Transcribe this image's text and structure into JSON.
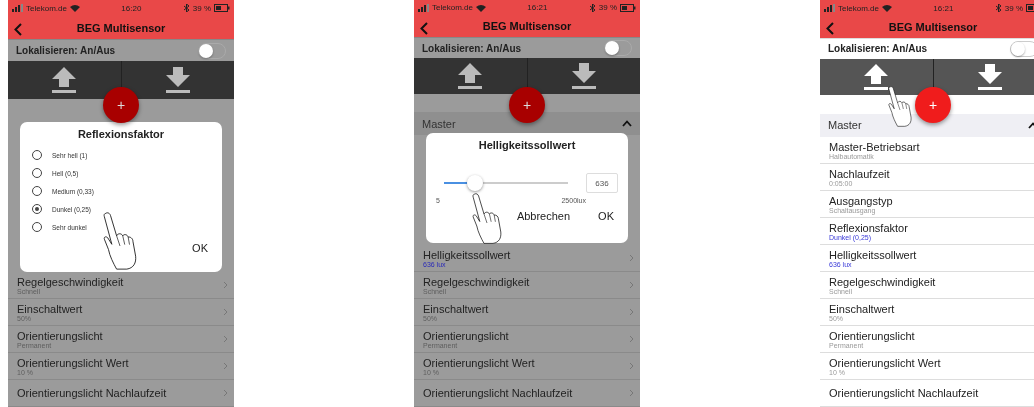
{
  "phones": [
    {
      "dimmed": true,
      "status": {
        "carrier": "Telekom.de",
        "time": "16:20",
        "battery": "39 %"
      },
      "title": "BEG Multisensor",
      "locate": {
        "label": "Lokalisieren: An/Aus",
        "on": false
      },
      "plus": "+",
      "dialog": {
        "kind": "radio",
        "title": "Reflexionsfaktor",
        "options": [
          {
            "label": "Sehr hell (1)",
            "selected": false
          },
          {
            "label": "Hell (0,5)",
            "selected": false
          },
          {
            "label": "Medium (0,33)",
            "selected": false
          },
          {
            "label": "Dunkel (0,25)",
            "selected": true
          },
          {
            "label": "Sehr dunkel",
            "selected": false
          }
        ],
        "buttons": [
          "OK"
        ]
      },
      "rows": [
        {
          "title": "Regelgeschwindigkeit",
          "value": "Schnell",
          "highlighted": false
        },
        {
          "title": "Einschaltwert",
          "value": "50%",
          "highlighted": false
        },
        {
          "title": "Orientierungslicht",
          "value": "Permanent",
          "highlighted": false
        },
        {
          "title": "Orientierungslicht Wert",
          "value": "10 %",
          "highlighted": false
        },
        {
          "title": "Orientierungslicht Nachlaufzeit"
        }
      ]
    },
    {
      "dimmed": true,
      "status": {
        "carrier": "Telekom.de",
        "time": "16:21",
        "battery": "39 %"
      },
      "title": "BEG Multisensor",
      "locate": {
        "label": "Lokalisieren: An/Aus",
        "on": false
      },
      "plus": "+",
      "section": {
        "label": "Master",
        "expanded": true
      },
      "dialog": {
        "kind": "slider",
        "title": "Helligkeitssollwert",
        "level": 0.25,
        "min": "5",
        "max": "2500lux",
        "value": "636",
        "buttons": [
          "Abbrechen",
          "OK"
        ]
      },
      "rows": [
        {
          "title": "Helligkeitssollwert",
          "value": "636 lux",
          "highlighted": true
        },
        {
          "title": "Regelgeschwindigkeit",
          "value": "Schnell",
          "highlighted": false
        },
        {
          "title": "Einschaltwert",
          "value": "50%",
          "highlighted": false
        },
        {
          "title": "Orientierungslicht",
          "value": "Permanent",
          "highlighted": false
        },
        {
          "title": "Orientierungslicht Wert",
          "value": "10 %",
          "highlighted": false
        },
        {
          "title": "Orientierungslicht Nachlaufzeit"
        }
      ]
    },
    {
      "dimmed": false,
      "status": {
        "carrier": "Telekom.de",
        "time": "16:21",
        "battery": "39 %"
      },
      "title": "BEG Multisensor",
      "locate": {
        "label": "Lokalisieren: An/Aus",
        "on": false
      },
      "plus": "+",
      "section": {
        "label": "Master",
        "expanded": true
      },
      "rows": [
        {
          "title": "Master-Betriebsart",
          "value": "Halbautomatik",
          "highlighted": false
        },
        {
          "title": "Nachlaufzeit",
          "value": "0:05:00",
          "highlighted": false
        },
        {
          "title": "Ausgangstyp",
          "value": "Schaltausgang",
          "highlighted": false
        },
        {
          "title": "Reflexionsfaktor",
          "value": "Dunkel (0,25)",
          "highlighted": true
        },
        {
          "title": "Helligkeitssollwert",
          "value": "636 lux",
          "highlighted": true
        },
        {
          "title": "Regelgeschwindigkeit",
          "value": "Schnell",
          "highlighted": false
        },
        {
          "title": "Einschaltwert",
          "value": "50%",
          "highlighted": false
        },
        {
          "title": "Orientierungslicht",
          "value": "Permanent",
          "highlighted": false
        },
        {
          "title": "Orientierungslicht Wert",
          "value": "10 %",
          "highlighted": false
        },
        {
          "title": "Orientierungslicht Nachlaufzeit"
        }
      ]
    }
  ]
}
